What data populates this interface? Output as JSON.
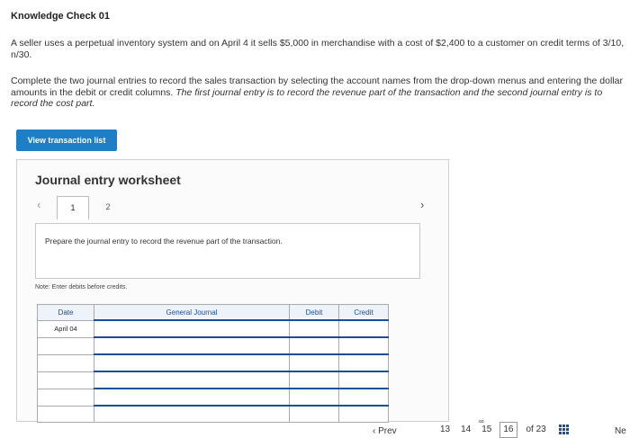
{
  "page": {
    "title": "Knowledge Check 01",
    "para1": "A seller uses a perpetual inventory system and on April 4 it sells $5,000 in merchandise with a cost of $2,400 to a customer on credit terms of 3/10, n/30.",
    "para2_main": "Complete the two journal entries to record the sales transaction by selecting the account names from the drop-down menus and entering the dollar amounts in the debit or credit columns. ",
    "para2_italic": "The first journal entry is to record the revenue part of the transaction and the second journal entry is to record the cost part."
  },
  "button": {
    "view_transactions": "View transaction list"
  },
  "worksheet": {
    "title": "Journal entry worksheet",
    "tabs": [
      "1",
      "2"
    ],
    "prompt": "Prepare the journal entry to record the revenue part of the transaction.",
    "note": "Note: Enter debits before credits.",
    "columns": {
      "date": "Date",
      "general_journal": "General Journal",
      "debit": "Debit",
      "credit": "Credit"
    },
    "rows": [
      {
        "date": "April 04"
      },
      {
        "date": ""
      },
      {
        "date": ""
      },
      {
        "date": ""
      },
      {
        "date": ""
      },
      {
        "date": ""
      }
    ]
  },
  "footer": {
    "prev": "Prev",
    "pages": [
      "13",
      "14",
      "15",
      "16"
    ],
    "of_text": "of 23",
    "next": "Ne"
  }
}
